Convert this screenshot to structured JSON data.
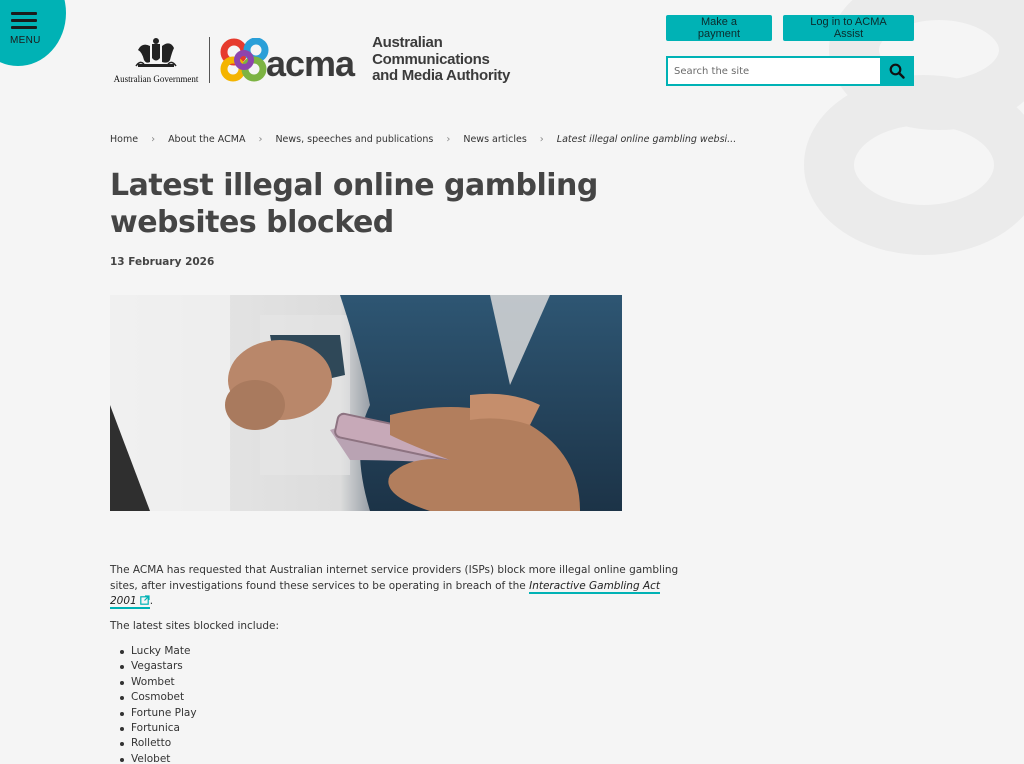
{
  "header": {
    "menu_label": "MENU",
    "gov_logo_text": "Australian Government",
    "acma_wordmark": "acma",
    "acma_name_lines": [
      "Australian",
      "Communications",
      "and Media Authority"
    ],
    "buttons": {
      "payment": "Make a payment",
      "login": "Log in to ACMA Assist"
    },
    "search": {
      "placeholder": "Search the site"
    }
  },
  "breadcrumb": {
    "items": [
      "Home",
      "About the ACMA",
      "News, speeches and publications",
      "News articles"
    ],
    "current": "Latest illegal online gambling websi..."
  },
  "article": {
    "title": "Latest illegal online gambling websites blocked",
    "date": "13 February 2026",
    "intro_before": "The ACMA has requested that Australian internet service providers (ISPs) block more illegal online gambling sites, after investigations found these services to be operating in breach of the ",
    "intro_link": "Interactive Gambling Act 2001",
    "intro_after": ".",
    "list_heading": "The latest sites blocked include:",
    "sites": [
      "Lucky Mate",
      "Vegastars",
      "Wombet",
      "Cosmobet",
      "Fortune Play",
      "Fortunica",
      "Rolletto",
      "Velobet"
    ]
  },
  "colors": {
    "accent": "#00b2b5",
    "background": "#f5f5f5",
    "title": "#454545"
  }
}
